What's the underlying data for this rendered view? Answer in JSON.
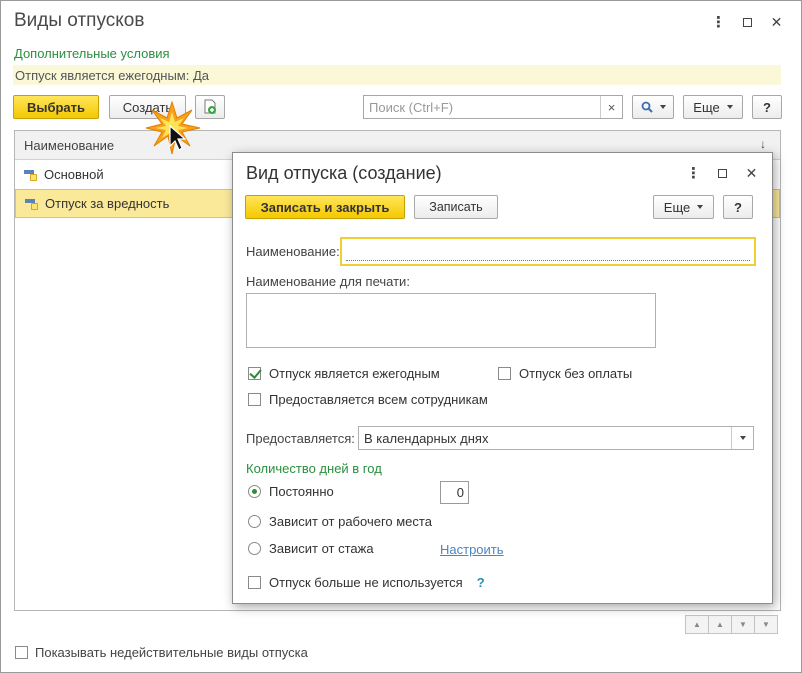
{
  "window": {
    "title": "Виды отпусков",
    "controls": [
      "more-icon",
      "maximize-icon",
      "close-icon"
    ]
  },
  "conditions": {
    "title": "Дополнительные условия",
    "text": "Отпуск является ежегодным: Да"
  },
  "toolbar": {
    "select_label": "Выбрать",
    "create_label": "Создать",
    "copy_icon": "add-copy-icon",
    "search_placeholder": "Поиск (Ctrl+F)",
    "clear_label": "×",
    "more_label": "Еще",
    "help_label": "?"
  },
  "list": {
    "column": "Наименование",
    "rows": [
      {
        "label": "Основной",
        "selected": false
      },
      {
        "label": "Отпуск за вредность",
        "selected": true
      }
    ]
  },
  "footer": {
    "show_invalid_label": "Показывать недействительные виды отпуска",
    "show_invalid_checked": false
  },
  "modal": {
    "title": "Вид отпуска (создание)",
    "save_close_label": "Записать и закрыть",
    "save_label": "Записать",
    "more_label": "Еще",
    "help_label": "?",
    "name_label": "Наименование:",
    "name_value": "",
    "print_name_label": "Наименование для печати:",
    "print_name_value": "",
    "annual_label": "Отпуск является ежегодным",
    "annual_checked": true,
    "unpaid_label": "Отпуск без оплаты",
    "unpaid_checked": false,
    "all_employees_label": "Предоставляется всем сотрудникам",
    "all_employees_checked": false,
    "provided_label": "Предоставляется:",
    "provided_value": "В календарных днях",
    "days_group_title": "Количество дней в год",
    "radio_constant": "Постоянно",
    "radio_workplace": "Зависит от рабочего места",
    "radio_seniority": "Зависит от стажа",
    "selected_radio": "constant",
    "days_value": "0",
    "configure_link": "Настроить",
    "not_used_label": "Отпуск больше не используется",
    "not_used_help": "?",
    "not_used_checked": false
  },
  "colors": {
    "accent_green": "#2a8f3e",
    "primary_yellow": "#f5c800",
    "selection": "#fbe99a",
    "link": "#4b84c4"
  }
}
